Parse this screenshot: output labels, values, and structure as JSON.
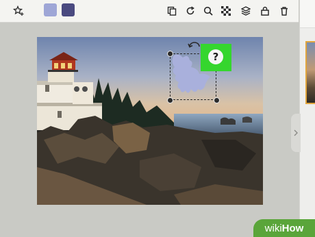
{
  "toolbar": {
    "icons": [
      "star-plus-icon",
      "duplicate-icon",
      "refresh-icon",
      "search-icon",
      "checkerboard-icon",
      "layers-icon",
      "lock-icon",
      "trash-icon"
    ],
    "swatches": [
      {
        "name": "light-periwinkle-swatch",
        "color": "#9ea6d6"
      },
      {
        "name": "dark-indigo-swatch",
        "color": "#4a4a80"
      }
    ]
  },
  "canvas": {
    "sticker_color": "#a9b0dc",
    "highlight_color": "#35d62e",
    "highlight_glyph": "?"
  },
  "watermark": {
    "part1": "wiki",
    "part2": "How"
  }
}
